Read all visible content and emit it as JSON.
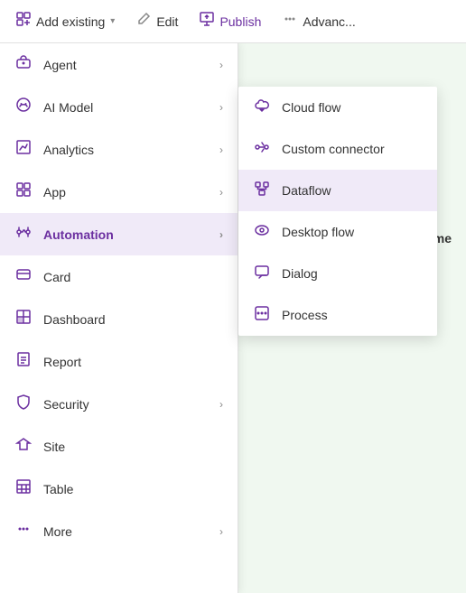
{
  "toolbar": {
    "add_existing_label": "Add existing",
    "edit_label": "Edit",
    "publish_label": "Publish",
    "advance_label": "Advanc..."
  },
  "left_menu": {
    "items": [
      {
        "id": "agent",
        "label": "Agent",
        "hasChevron": true
      },
      {
        "id": "ai-model",
        "label": "AI Model",
        "hasChevron": true
      },
      {
        "id": "analytics",
        "label": "Analytics",
        "hasChevron": true
      },
      {
        "id": "app",
        "label": "App",
        "hasChevron": true
      },
      {
        "id": "automation",
        "label": "Automation",
        "hasChevron": true,
        "active": true
      },
      {
        "id": "card",
        "label": "Card",
        "hasChevron": false
      },
      {
        "id": "dashboard",
        "label": "Dashboard",
        "hasChevron": false
      },
      {
        "id": "report",
        "label": "Report",
        "hasChevron": false
      },
      {
        "id": "security",
        "label": "Security",
        "hasChevron": true
      },
      {
        "id": "site",
        "label": "Site",
        "hasChevron": false
      },
      {
        "id": "table",
        "label": "Table",
        "hasChevron": false
      },
      {
        "id": "more",
        "label": "More",
        "hasChevron": true
      }
    ]
  },
  "submenu": {
    "items": [
      {
        "id": "cloud-flow",
        "label": "Cloud flow"
      },
      {
        "id": "custom-connector",
        "label": "Custom connector"
      },
      {
        "id": "dataflow",
        "label": "Dataflow",
        "active": true
      },
      {
        "id": "desktop-flow",
        "label": "Desktop flow"
      },
      {
        "id": "dialog",
        "label": "Dialog"
      },
      {
        "id": "process",
        "label": "Process"
      }
    ]
  },
  "right_panel": {
    "name_header": "Name"
  },
  "colors": {
    "purple": "#6b2fa0",
    "light_green_bg": "#f0f8f0"
  }
}
